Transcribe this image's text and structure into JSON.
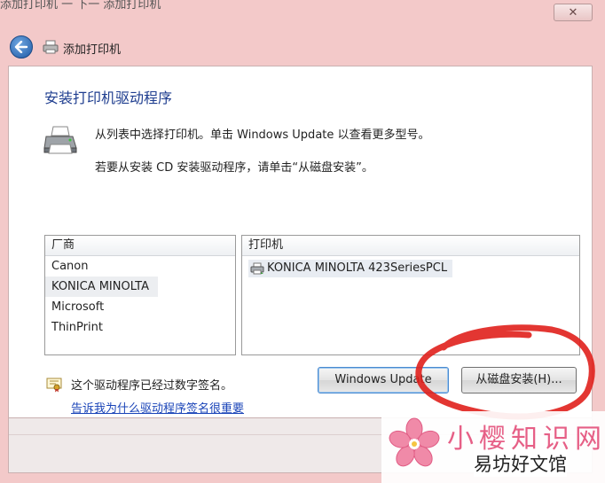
{
  "window": {
    "top_fragment": "添加打印机    一 下一 添加打印机",
    "close_label": "✕"
  },
  "nav": {
    "title": "添加打印机"
  },
  "page": {
    "heading": "安装打印机驱动程序",
    "desc_line1": "从列表中选择打印机。单击 Windows Update 以查看更多型号。",
    "desc_line2": "若要从安装 CD 安装驱动程序，请单击“从磁盘安装”。"
  },
  "manufacturers": {
    "header": "厂商",
    "items": [
      "Canon",
      "KONICA MINOLTA",
      "Microsoft",
      "ThinPrint"
    ],
    "selected": "KONICA MINOLTA"
  },
  "printers": {
    "header": "打印机",
    "items": [
      "KONICA MINOLTA 423SeriesPCL"
    ]
  },
  "signature": {
    "status": "这个驱动程序已经过数字签名。",
    "link": "告诉我为什么驱动程序签名很重要"
  },
  "buttons": {
    "windows_update": "Windows Update",
    "have_disk": "从磁盘安装(H)..."
  },
  "watermark": {
    "line1": "小樱知识网",
    "line2": "易坊好文馆"
  },
  "colors": {
    "heading": "#1e3d8f",
    "link": "#1a44b8",
    "annotation_circle": "#e0201c",
    "watermark_pink": "#e65f86"
  }
}
